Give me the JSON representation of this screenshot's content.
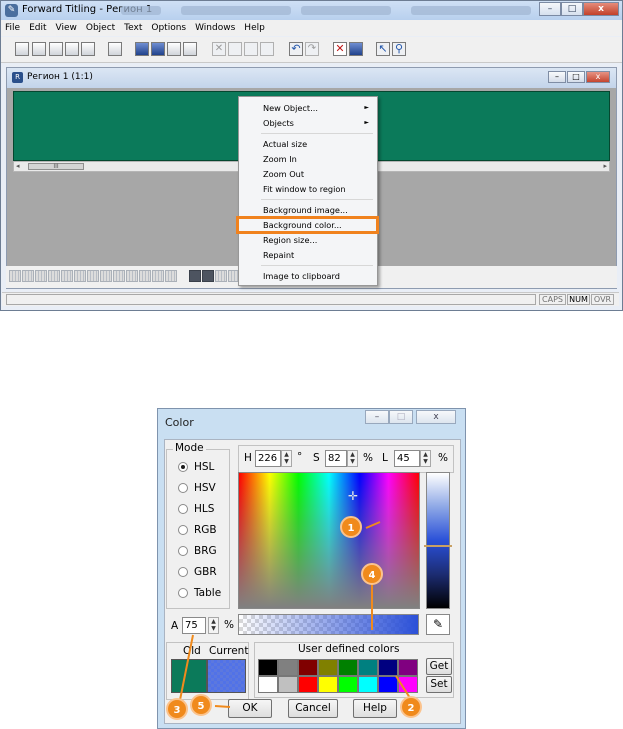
{
  "app": {
    "title": "Forward Titling - Регион 1",
    "window_buttons": {
      "minimize": "–",
      "maximize": "□",
      "close": "x"
    }
  },
  "menubar": [
    "File",
    "Edit",
    "View",
    "Object",
    "Text",
    "Options",
    "Windows",
    "Help"
  ],
  "mdi": {
    "title": "Регион 1  (1:1)",
    "scroll_thumb": "III",
    "canvas_color": "#0b7a5a"
  },
  "context_menu": {
    "items": [
      {
        "label": "New Object...",
        "submenu": true
      },
      {
        "label": "Objects",
        "submenu": true
      },
      {
        "label": "Actual size"
      },
      {
        "label": "Zoom In"
      },
      {
        "label": "Zoom Out"
      },
      {
        "label": "Fit window to region"
      },
      {
        "label": "Background image..."
      },
      {
        "label": "Background color...",
        "highlighted": true
      },
      {
        "label": "Region size..."
      },
      {
        "label": "Repaint"
      },
      {
        "label": "Image to clipboard"
      }
    ],
    "submenu_arrow": "►",
    "highlight_color": "#f0821e"
  },
  "statusbar": {
    "caps": "CAPS",
    "num": "NUM",
    "ovr": "OVR"
  },
  "color_dialog": {
    "title": "Color",
    "mode": {
      "label": "Mode",
      "options": [
        "HSL",
        "HSV",
        "HLS",
        "RGB",
        "BRG",
        "GBR",
        "Table"
      ],
      "selected": "HSL"
    },
    "hsl": {
      "h_label": "H",
      "h_value": "226",
      "h_unit": "°",
      "s_label": "S",
      "s_value": "82",
      "s_unit": "%",
      "l_label": "L",
      "l_value": "45",
      "l_unit": "%"
    },
    "alpha": {
      "label": "A",
      "value": "75",
      "unit": "%"
    },
    "old_label": "Old",
    "current_label": "Current",
    "old_color": "#0b7a5a",
    "current_color": "#2b50d8",
    "user_defined": {
      "label": "User defined colors",
      "row1": [
        "#000000",
        "#808080",
        "#800000",
        "#808000",
        "#008000",
        "#008080",
        "#000080",
        "#800080"
      ],
      "row2": [
        "#ffffff",
        "#c0c0c0",
        "#ff0000",
        "#ffff00",
        "#00ff00",
        "#00ffff",
        "#0000ff",
        "#ff00ff"
      ],
      "get_label": "Get",
      "set_label": "Set"
    },
    "buttons": {
      "ok": "OK",
      "cancel": "Cancel",
      "help": "Help"
    },
    "crosshair": "✛",
    "eyedropper": "✎"
  },
  "callouts": [
    "1",
    "2",
    "3",
    "4",
    "5"
  ]
}
